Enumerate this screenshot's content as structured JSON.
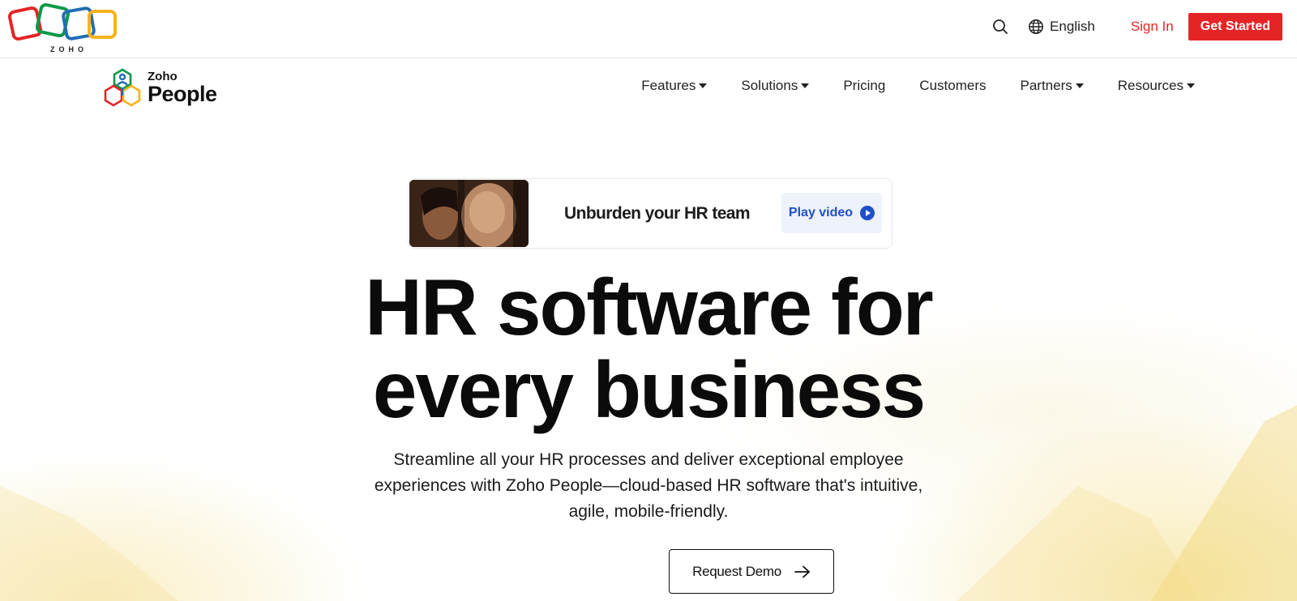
{
  "topbar": {
    "brand_wordmark": "ZOHO",
    "search_icon": "search-icon",
    "language": {
      "icon": "globe-icon",
      "label": "English"
    },
    "sign_in_label": "Sign In",
    "get_started_label": "Get Started",
    "accent_color": "#e42527"
  },
  "product_nav": {
    "logo": {
      "brand": "Zoho",
      "product": "People"
    },
    "items": [
      {
        "label": "Features",
        "has_dropdown": true
      },
      {
        "label": "Solutions",
        "has_dropdown": true
      },
      {
        "label": "Pricing",
        "has_dropdown": false
      },
      {
        "label": "Customers",
        "has_dropdown": false
      },
      {
        "label": "Partners",
        "has_dropdown": true
      },
      {
        "label": "Resources",
        "has_dropdown": true
      }
    ]
  },
  "video_card": {
    "title": "Unburden your HR team",
    "play_label": "Play video",
    "play_color": "#1f4fc9"
  },
  "hero": {
    "headline_line1": "HR software for",
    "headline_line2": "every business",
    "subtext": "Streamline all your HR processes and deliver exceptional employee experiences with Zoho People—cloud-based HR software that's intuitive, agile, mobile-friendly.",
    "cta_label": "Request Demo",
    "cta_icon": "arrow-right-icon"
  }
}
